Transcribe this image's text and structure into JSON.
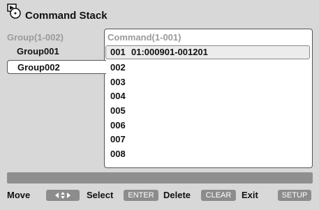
{
  "title": "Command Stack",
  "groups": {
    "header": "Group(1-002)",
    "items": [
      "Group001",
      "Group002"
    ]
  },
  "commands": {
    "header": "Command(1-001)",
    "rows": [
      {
        "num": "001",
        "detail": "01:000901-001201"
      },
      {
        "num": "002",
        "detail": ""
      },
      {
        "num": "003",
        "detail": ""
      },
      {
        "num": "004",
        "detail": ""
      },
      {
        "num": "005",
        "detail": ""
      },
      {
        "num": "006",
        "detail": ""
      },
      {
        "num": "007",
        "detail": ""
      },
      {
        "num": "008",
        "detail": ""
      }
    ]
  },
  "footer": {
    "move_label": "Move",
    "move_key": "⬩⬩",
    "select_label": "Select",
    "select_key": "ENTER",
    "delete_label": "Delete",
    "delete_key": "CLEAR",
    "exit_label": "Exit",
    "exit_key": "SETUP"
  },
  "colors": {
    "background": "#d8d8d8",
    "panel": "#ffffff",
    "key_bg": "#8c8c8c",
    "status_bar": "#8f8f8f"
  },
  "icons": {
    "title": "disc-menu-icon",
    "move": "four-way-arrow-icon"
  }
}
